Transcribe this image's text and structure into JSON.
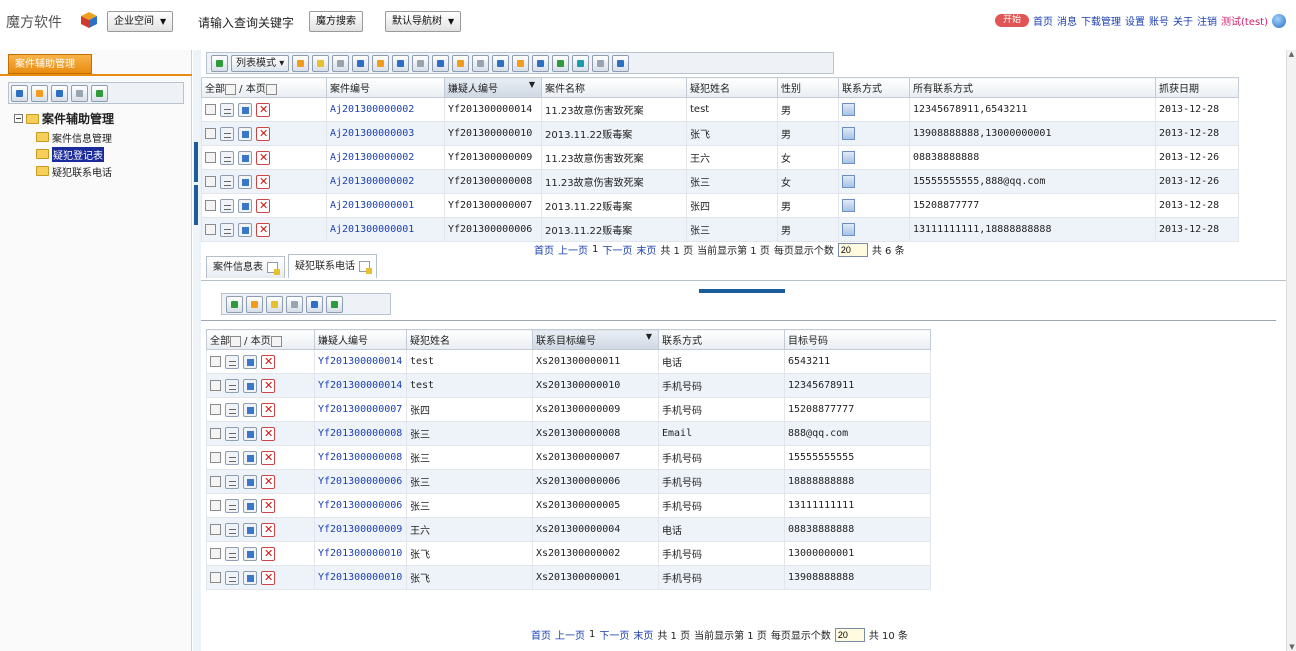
{
  "header": {
    "app_name": "魔方软件",
    "enterprise_space": "企业空间",
    "search_label": "请输入查询关键字",
    "search_button": "魔方搜索",
    "default_nav": "默认导航树",
    "start": "开始",
    "links": [
      "首页",
      "消息",
      "下载管理",
      "设置",
      "账号",
      "关于",
      "注销"
    ],
    "user": "测试(test)"
  },
  "sidebar": {
    "tab": "案件辅助管理",
    "root": "案件辅助管理",
    "items": [
      "案件信息管理",
      "疑犯登记表",
      "疑犯联系电话"
    ],
    "selected_index": 1
  },
  "upper": {
    "list_mode": "列表模式",
    "headers": [
      "全部",
      "本页",
      "案件编号",
      "嫌疑人编号",
      "案件名称",
      "疑犯姓名",
      "性别",
      "联系方式",
      "所有联系方式",
      "抓获日期"
    ],
    "rows": [
      [
        "Aj201300000002",
        "Yf201300000014",
        "11.23故意伤害致死案",
        "test",
        "男",
        "12345678911,6543211",
        "2013-12-28"
      ],
      [
        "Aj201300000003",
        "Yf201300000010",
        "2013.11.22贩毒案",
        "张飞",
        "男",
        "13908888888,13000000001",
        "2013-12-28"
      ],
      [
        "Aj201300000002",
        "Yf201300000009",
        "11.23故意伤害致死案",
        "王六",
        "女",
        "08838888888",
        "2013-12-26"
      ],
      [
        "Aj201300000002",
        "Yf201300000008",
        "11.23故意伤害致死案",
        "张三",
        "女",
        "15555555555,888@qq.com",
        "2013-12-26"
      ],
      [
        "Aj201300000001",
        "Yf201300000007",
        "2013.11.22贩毒案",
        "张四",
        "男",
        "15208877777",
        "2013-12-28"
      ],
      [
        "Aj201300000001",
        "Yf201300000006",
        "2013.11.22贩毒案",
        "张三",
        "男",
        "13111111111,18888888888",
        "2013-12-28"
      ]
    ],
    "pager": {
      "first": "首页",
      "prev": "上一页",
      "page": "1",
      "next": "下一页",
      "last": "末页",
      "total_pages": "共 1 页",
      "current": "当前显示第 1 页",
      "per_page_label": "每页显示个数",
      "per_page": "20",
      "total": "共 6 条"
    }
  },
  "tabs": [
    "案件信息表",
    "疑犯联系电话"
  ],
  "lower": {
    "headers": [
      "全部",
      "本页",
      "嫌疑人编号",
      "疑犯姓名",
      "联系目标编号",
      "联系方式",
      "目标号码"
    ],
    "rows": [
      [
        "Yf201300000014",
        "test",
        "Xs201300000011",
        "电话",
        "6543211"
      ],
      [
        "Yf201300000014",
        "test",
        "Xs201300000010",
        "手机号码",
        "12345678911"
      ],
      [
        "Yf201300000007",
        "张四",
        "Xs201300000009",
        "手机号码",
        "15208877777"
      ],
      [
        "Yf201300000008",
        "张三",
        "Xs201300000008",
        "Email",
        "888@qq.com"
      ],
      [
        "Yf201300000008",
        "张三",
        "Xs201300000007",
        "手机号码",
        "15555555555"
      ],
      [
        "Yf201300000006",
        "张三",
        "Xs201300000006",
        "手机号码",
        "18888888888"
      ],
      [
        "Yf201300000006",
        "张三",
        "Xs201300000005",
        "手机号码",
        "13111111111"
      ],
      [
        "Yf201300000009",
        "王六",
        "Xs201300000004",
        "电话",
        "08838888888"
      ],
      [
        "Yf201300000010",
        "张飞",
        "Xs201300000002",
        "手机号码",
        "13000000001"
      ],
      [
        "Yf201300000010",
        "张飞",
        "Xs201300000001",
        "手机号码",
        "13908888888"
      ]
    ],
    "pager": {
      "first": "首页",
      "prev": "上一页",
      "page": "1",
      "next": "下一页",
      "last": "末页",
      "total_pages": "共 1 页",
      "current": "当前显示第 1 页",
      "per_page_label": "每页显示个数",
      "per_page": "20",
      "total": "共 10 条"
    }
  }
}
